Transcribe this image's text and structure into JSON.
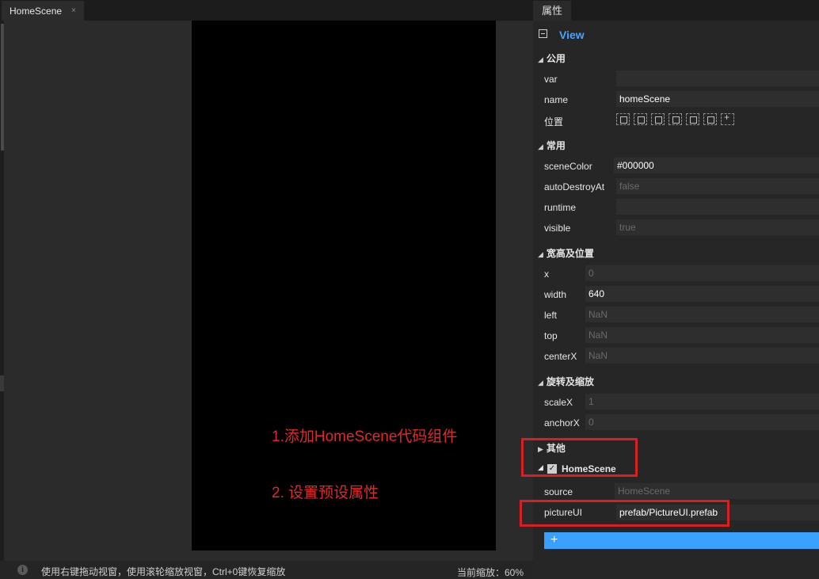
{
  "editor": {
    "tab_label": "HomeScene",
    "tab_close": "×",
    "status_text": "使用右键拖动视窗，使用滚轮缩放视窗，Ctrl+0键恢复缩放",
    "zoom_text": "当前缩放：60%",
    "info_icon": "i"
  },
  "annotations": {
    "step1": "1.添加HomeScene代码组件",
    "step2": "2. 设置预设属性",
    "color": "#e02a2a"
  },
  "panel": {
    "tab_label": "属性",
    "view_title": "View",
    "sections": {
      "common": "公用",
      "frequent": "常用",
      "size_pos": "宽高及位置",
      "rotate_scale": "旋转及缩放",
      "other": "其他",
      "component": "HomeScene"
    },
    "props": {
      "var": {
        "label": "var",
        "value": ""
      },
      "name": {
        "label": "name",
        "value": "homeScene"
      },
      "position": {
        "label": "位置"
      },
      "sceneColor": {
        "label": "sceneColor",
        "value": "#000000"
      },
      "autoDestroyAt": {
        "label": "autoDestroyAt",
        "value": "false"
      },
      "runtime": {
        "label": "runtime",
        "value": ""
      },
      "visible": {
        "label": "visible",
        "value": "true"
      },
      "x": {
        "label": "x",
        "value": "0"
      },
      "width": {
        "label": "width",
        "value": "640"
      },
      "left": {
        "label": "left",
        "value": "NaN"
      },
      "top": {
        "label": "top",
        "value": "NaN"
      },
      "centerX": {
        "label": "centerX",
        "value": "NaN"
      },
      "scaleX": {
        "label": "scaleX",
        "value": "1"
      },
      "anchorX": {
        "label": "anchorX",
        "value": "0"
      },
      "source": {
        "label": "source",
        "value": "HomeScene"
      },
      "pictureUI": {
        "label": "pictureUI",
        "value": "prefab/PictureUI.prefab"
      }
    },
    "add_button": "+",
    "accent": "#3aa0ff"
  }
}
